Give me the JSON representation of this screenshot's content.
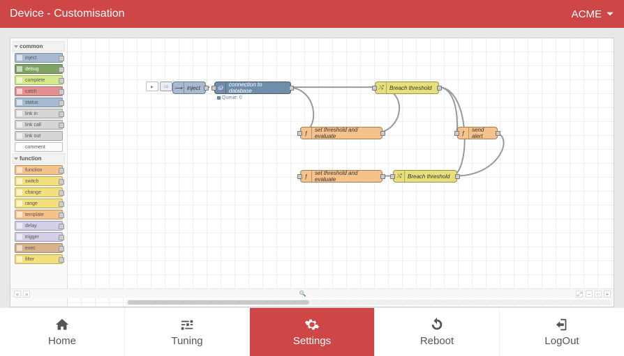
{
  "header": {
    "title": "Device - Customisation",
    "org": "ACME"
  },
  "palette": {
    "groups": [
      {
        "name": "common",
        "items": [
          {
            "label": "inject",
            "cls": "pi-blue"
          },
          {
            "label": "debug",
            "cls": "pi-green"
          },
          {
            "label": "complete",
            "cls": "pi-lime"
          },
          {
            "label": "catch",
            "cls": "pi-catch"
          },
          {
            "label": "status",
            "cls": "pi-blue"
          },
          {
            "label": "link in",
            "cls": "pi-grey"
          },
          {
            "label": "link call",
            "cls": "pi-grey"
          },
          {
            "label": "link out",
            "cls": "pi-grey",
            "noport": true
          },
          {
            "label": "comment",
            "cls": "pi-white",
            "noport": true
          }
        ]
      },
      {
        "name": "function",
        "items": [
          {
            "label": "function",
            "cls": "pi-orange"
          },
          {
            "label": "switch",
            "cls": "pi-yellow"
          },
          {
            "label": "change",
            "cls": "pi-yellow"
          },
          {
            "label": "range",
            "cls": "pi-yellow"
          },
          {
            "label": "template",
            "cls": "pi-orange"
          },
          {
            "label": "delay",
            "cls": "pi-violet"
          },
          {
            "label": "trigger",
            "cls": "pi-violet"
          },
          {
            "label": "exec",
            "cls": "pi-brown"
          },
          {
            "label": "filter",
            "cls": "pi-yellow"
          }
        ]
      }
    ]
  },
  "canvas": {
    "queue_label": "Queue: 0",
    "nodes": {
      "inject": {
        "label": "inject"
      },
      "conn": {
        "label": "connection to database"
      },
      "breach1": {
        "label": "Breach threshold"
      },
      "eval1": {
        "label": "set threshold and evaluate"
      },
      "sendalert": {
        "label": "send alert"
      },
      "eval2": {
        "label": "set threshold and evaluate"
      },
      "breach2": {
        "label": "Breach threshold"
      }
    }
  },
  "nav": {
    "home": "Home",
    "tuning": "Tuning",
    "settings": "Settings",
    "reboot": "Reboot",
    "logout": "LogOut"
  }
}
